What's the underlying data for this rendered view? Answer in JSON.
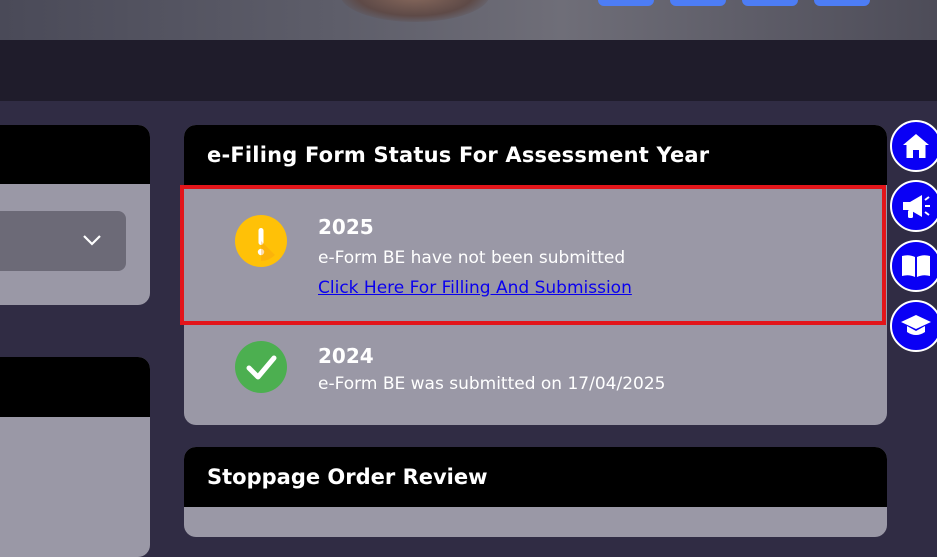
{
  "status_card": {
    "title": "e-Filing Form Status For Assessment Year",
    "items": [
      {
        "year": "2025",
        "message": "e-Form BE have not been submitted",
        "link": "Click Here For Filling And Submission",
        "status_icon": "warning-icon",
        "status_color": "#ffc107"
      },
      {
        "year": "2024",
        "message": "e-Form BE was submitted on 17/04/2025",
        "status_icon": "check-icon",
        "status_color": "#4caf50"
      }
    ]
  },
  "stoppage_card": {
    "title": "Stoppage Order Review"
  },
  "floating_menu": [
    {
      "icon": "home-icon"
    },
    {
      "icon": "megaphone-icon"
    },
    {
      "icon": "book-icon"
    },
    {
      "icon": "graduation-cap-icon"
    }
  ],
  "colors": {
    "highlight": "#e3151a",
    "link": "#0a00ee",
    "fab": "#0a00f5"
  }
}
